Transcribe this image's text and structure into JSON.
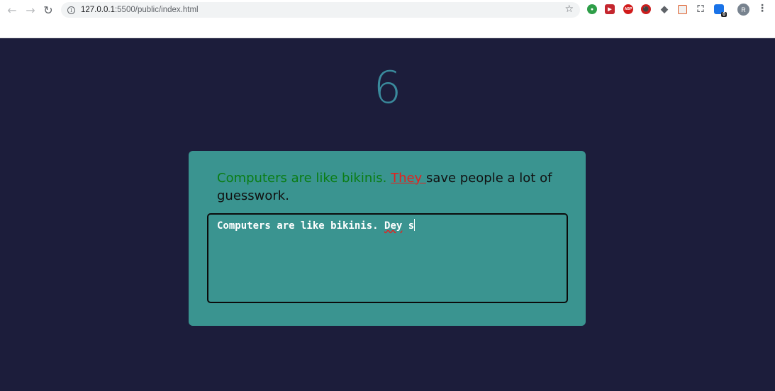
{
  "browser": {
    "url_host": "127.0.0.1",
    "url_path": ":5500/public/index.html",
    "profile_initial": "R",
    "extensions": [
      {
        "name": "ext-green-icon",
        "color": "#2e9e48",
        "glyph": "◉"
      },
      {
        "name": "ext-red-play-icon",
        "color": "#c4262e",
        "glyph": "▶"
      },
      {
        "name": "adblock-icon",
        "color": "#d11b1b",
        "glyph": "ABP"
      },
      {
        "name": "ublock-icon",
        "color": "#cc1d1d",
        "glyph": "⬢"
      },
      {
        "name": "eraser-icon",
        "color": "#5f6368",
        "glyph": "◆"
      },
      {
        "name": "window-icon",
        "color": "#e0602d",
        "glyph": "▭"
      },
      {
        "name": "screenshot-icon",
        "color": "#5f6368",
        "glyph": "⛶"
      },
      {
        "name": "ext-badge-icon",
        "color": "#1a73e8",
        "glyph": "0"
      }
    ]
  },
  "app": {
    "timer": "6",
    "quote": {
      "correct": "Computers are like bikinis. ",
      "incorrect": "They ",
      "pending": "save people a lot of guesswork."
    },
    "input": {
      "before_error": "Computers are like bikinis. ",
      "misspelled": "Dey",
      "after_error": " s"
    }
  }
}
